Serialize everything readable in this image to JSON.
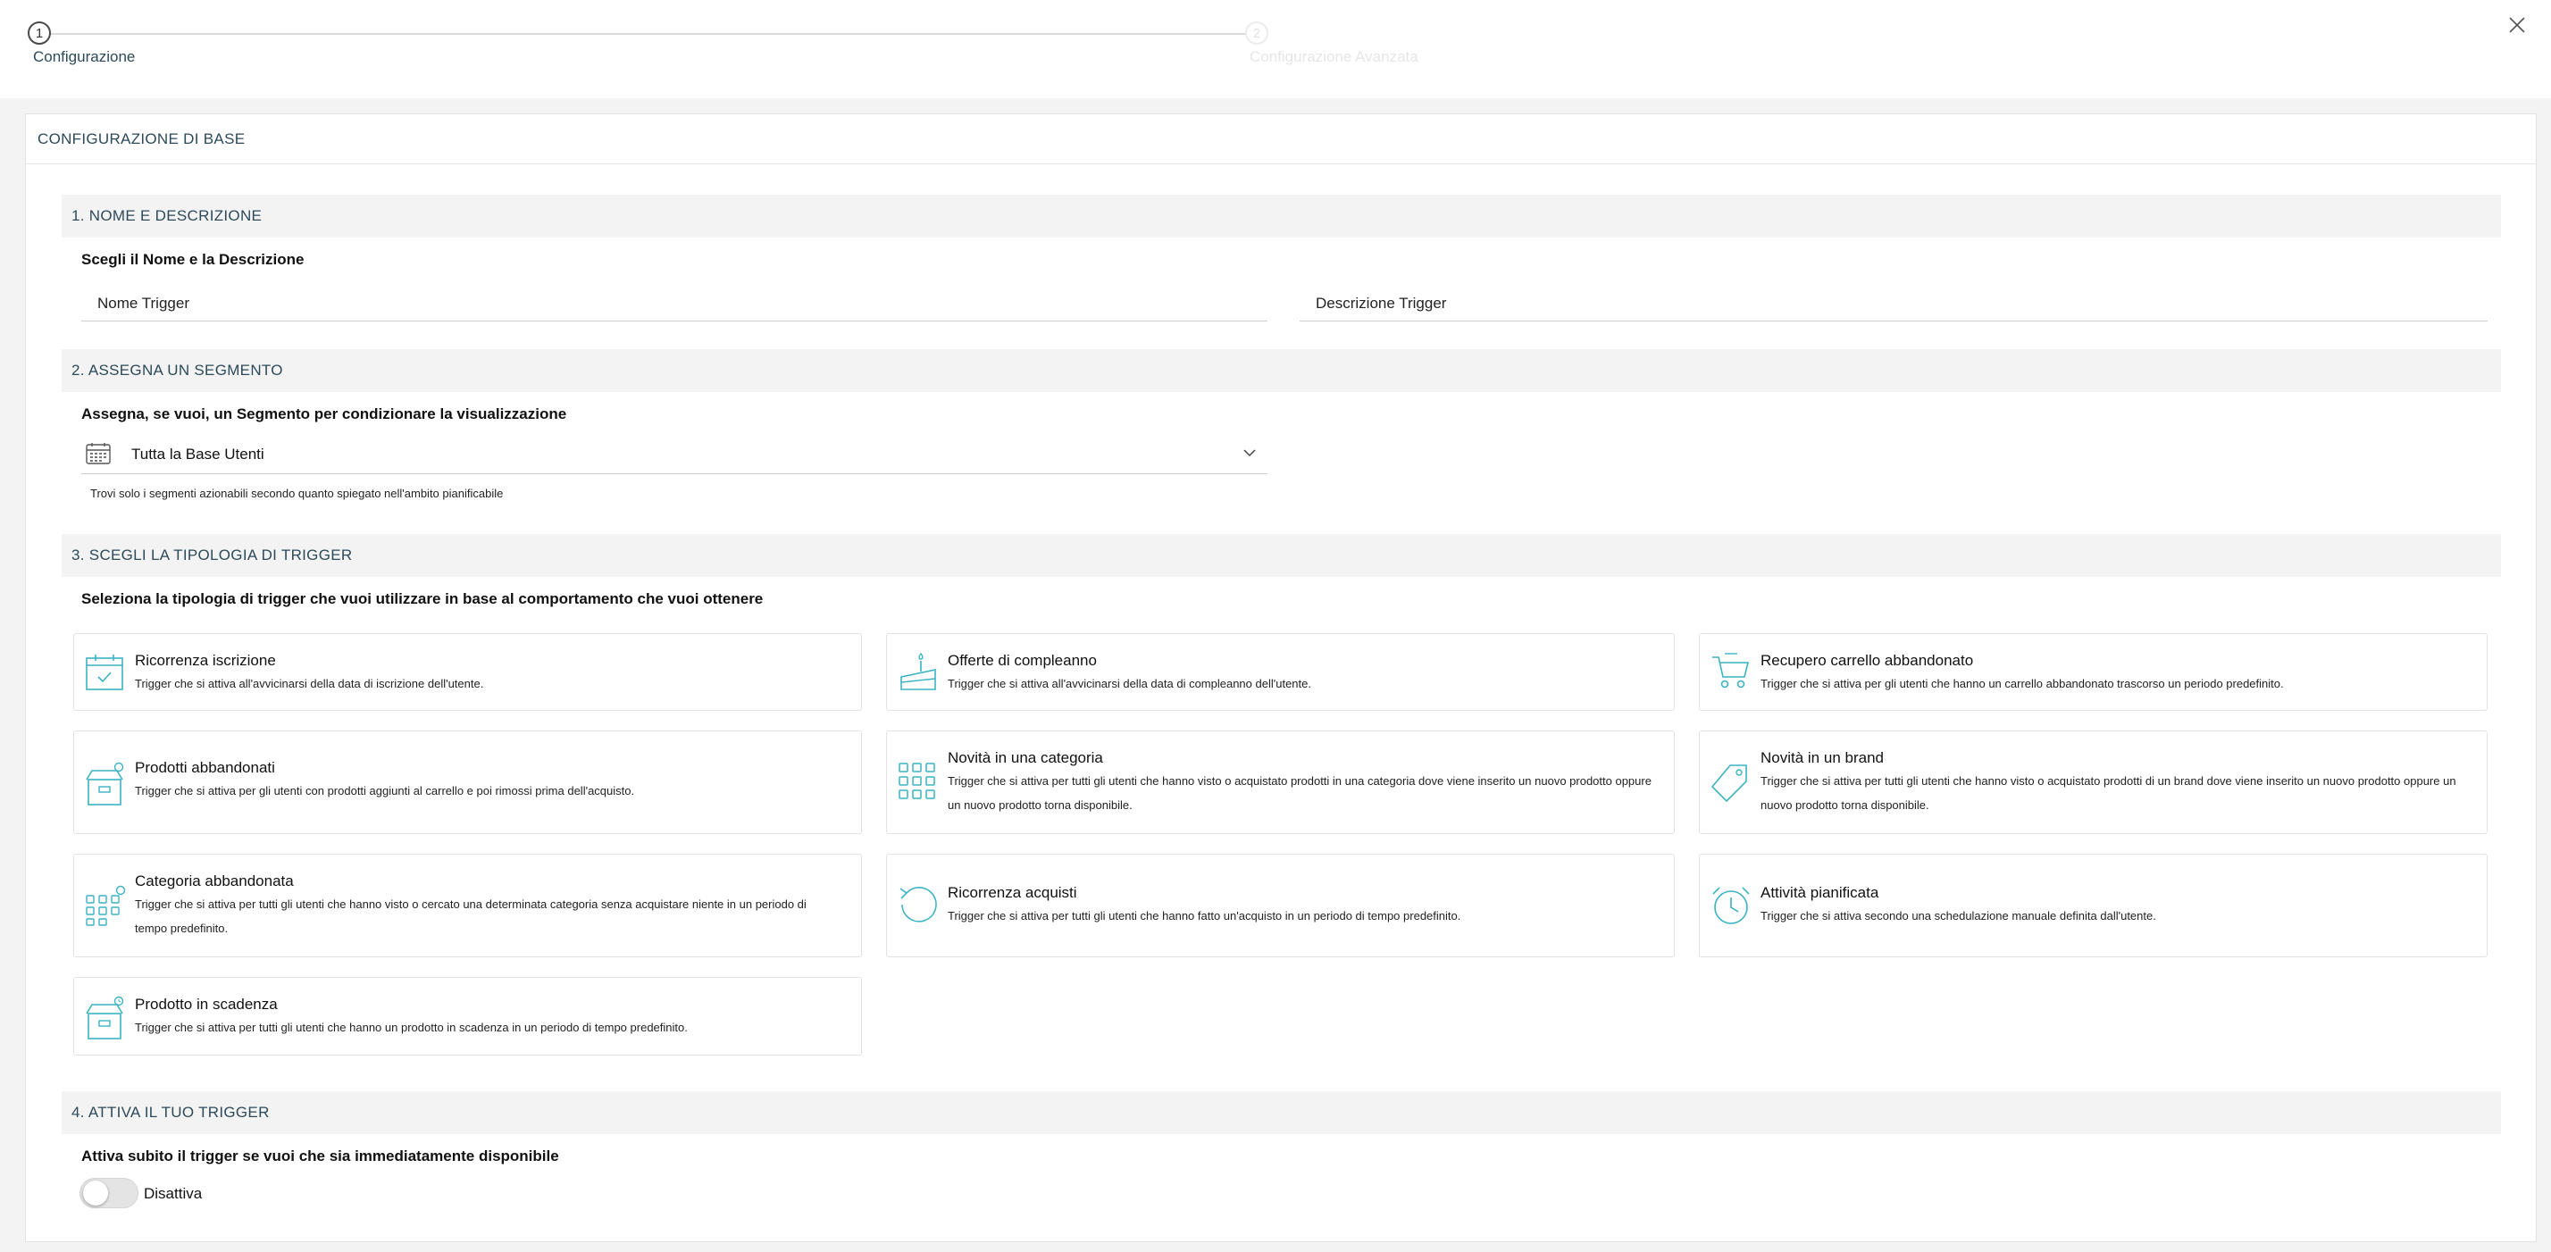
{
  "stepper": {
    "steps": [
      {
        "number": "1",
        "label": "Configurazione",
        "state": "active"
      },
      {
        "number": "2",
        "label": "Configurazione Avanzata",
        "state": "disabled"
      }
    ]
  },
  "card": {
    "title": "CONFIGURAZIONE DI BASE"
  },
  "section1": {
    "title": "1. NOME E DESCRIZIONE",
    "subtitle": "Scegli il Nome e la Descrizione",
    "name_placeholder": "Nome Trigger",
    "name_value": "",
    "description_placeholder": "Descrizione Trigger",
    "description_value": ""
  },
  "section2": {
    "title": "2. ASSEGNA UN SEGMENTO",
    "subtitle": "Assegna, se vuoi, un Segmento per condizionare la visualizzazione",
    "selected_segment": "Tutta la Base Utenti",
    "hint": "Trovi solo i segmenti azionabili secondo quanto spiegato nell'ambito pianificabile"
  },
  "section3": {
    "title": "3. SCEGLI LA TIPOLOGIA DI TRIGGER",
    "subtitle": "Seleziona la tipologia di trigger che vuoi utilizzare in base al comportamento che vuoi ottenere",
    "tiles": [
      {
        "icon": "calendar-check-icon",
        "title": "Ricorrenza iscrizione",
        "description": "Trigger che si attiva all'avvicinarsi della data di iscrizione dell'utente."
      },
      {
        "icon": "birthday-cake-icon",
        "title": "Offerte di compleanno",
        "description": "Trigger che si attiva all'avvicinarsi della data di compleanno dell'utente."
      },
      {
        "icon": "shopping-cart-icon",
        "title": "Recupero carrello abbandonato",
        "description": "Trigger che si attiva per gli utenti che hanno un carrello abbandonato trascorso un periodo predefinito."
      },
      {
        "icon": "abandoned-box-icon",
        "title": "Prodotti abbandonati",
        "description": "Trigger che si attiva per gli utenti con prodotti aggiunti al carrello e poi rimossi prima dell'acquisto."
      },
      {
        "icon": "grid-icon",
        "title": "Novità in una categoria",
        "description": "Trigger che si attiva per tutti gli utenti che hanno visto o acquistato prodotti in una categoria dove viene inserito un nuovo prodotto oppure un nuovo prodotto torna disponibile."
      },
      {
        "icon": "tag-icon",
        "title": "Novità in un brand",
        "description": "Trigger che si attiva per tutti gli utenti che hanno visto o acquistato prodotti di un brand dove viene inserito un nuovo prodotto oppure un nuovo prodotto torna disponibile."
      },
      {
        "icon": "grid-dots-icon",
        "title": "Categoria abbandonata",
        "description": "Trigger che si attiva per tutti gli utenti che hanno visto o cercato una determinata categoria senza acquistare niente in un periodo di tempo predefinito."
      },
      {
        "icon": "refresh-icon",
        "title": "Ricorrenza acquisti",
        "description": "Trigger che si attiva per tutti gli utenti che hanno fatto un'acquisto in un periodo di tempo predefinito."
      },
      {
        "icon": "alarm-clock-icon",
        "title": "Attività pianificata",
        "description": "Trigger che si attiva secondo una schedulazione manuale definita dall'utente."
      },
      {
        "icon": "expiring-box-icon",
        "title": "Prodotto in scadenza",
        "description": "Trigger che si attiva per tutti gli utenti che hanno un prodotto in scadenza in un periodo di tempo predefinito."
      }
    ]
  },
  "section4": {
    "title": "4. ATTIVA IL TUO TRIGGER",
    "subtitle": "Attiva subito il trigger se vuoi che sia immediatamente disponibile",
    "toggle_state": "off",
    "toggle_label": "Disattiva"
  },
  "colors": {
    "accent": "#3bb3c3",
    "heading": "#2c4a5a",
    "section_bg": "#f3f3f3"
  }
}
